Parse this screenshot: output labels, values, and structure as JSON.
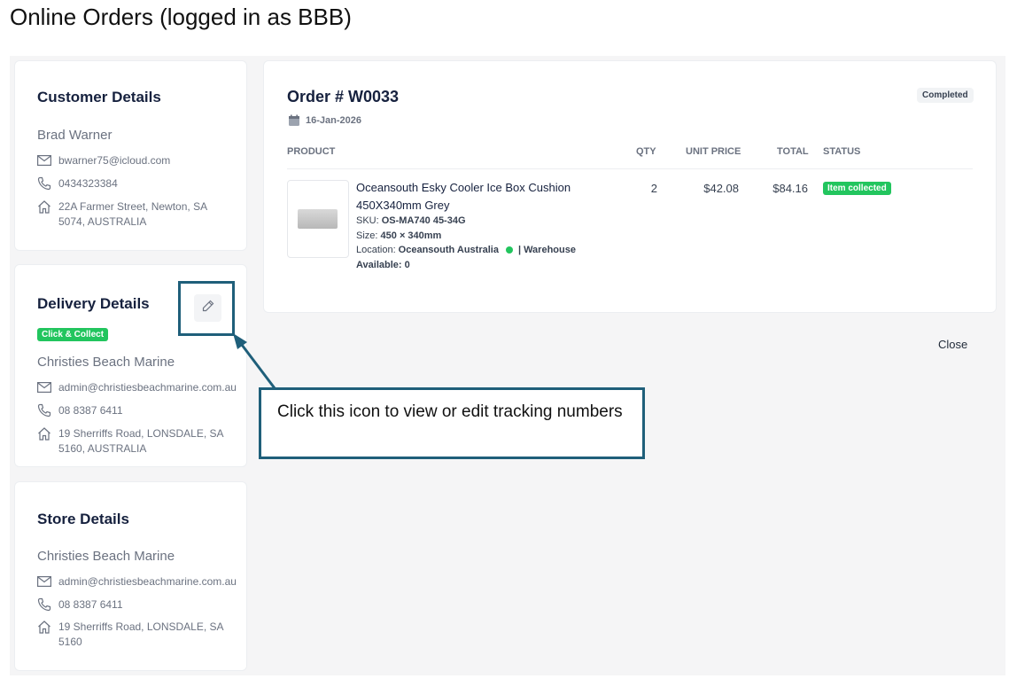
{
  "page_title": "Online Orders (logged in as BBB)",
  "customer": {
    "heading": "Customer Details",
    "name": "Brad Warner",
    "email": "bwarner75@icloud.com",
    "phone": "0434323384",
    "address": "22A Farmer Street, Newton, SA 5074, AUSTRALIA"
  },
  "delivery": {
    "heading": "Delivery Details",
    "badge": "Click & Collect",
    "name": "Christies Beach Marine",
    "email": "admin@christiesbeachmarine.com.au",
    "phone": "08 8387 6411",
    "address": "19 Sherriffs Road, LONSDALE, SA 5160, AUSTRALIA"
  },
  "store": {
    "heading": "Store Details",
    "name": "Christies Beach Marine",
    "email": "admin@christiesbeachmarine.com.au",
    "phone": "08 8387 6411",
    "address": "19 Sherriffs Road, LONSDALE, SA 5160"
  },
  "order": {
    "title": "Order # W0033",
    "status": "Completed",
    "date": "16-Jan-2026",
    "columns": {
      "product": "PRODUCT",
      "qty": "QTY",
      "unit_price": "UNIT PRICE",
      "total": "TOTAL",
      "status": "STATUS"
    },
    "item": {
      "name": "Oceansouth Esky Cooler Ice Box Cushion 450X340mm Grey",
      "sku_label": "SKU:",
      "sku": "OS-MA740 45-34G",
      "size_label": "Size:",
      "size": "450 × 340mm",
      "location_label": "Location:",
      "location": "Oceansouth Australia",
      "warehouse": "| Warehouse",
      "available_label": "Available:",
      "available": "0",
      "qty": "2",
      "unit_price": "$42.08",
      "total": "$84.16",
      "status": "Item collected"
    }
  },
  "close_label": "Close",
  "callout": "Click this icon to view or edit tracking numbers",
  "icons": {
    "email": "envelope-icon",
    "phone": "phone-icon",
    "address": "home-icon",
    "edit": "pencil-icon",
    "date": "calendar-icon"
  },
  "colors": {
    "accent_green": "#22c55e",
    "annotation": "#1f5f7a",
    "heading": "#16213e"
  }
}
